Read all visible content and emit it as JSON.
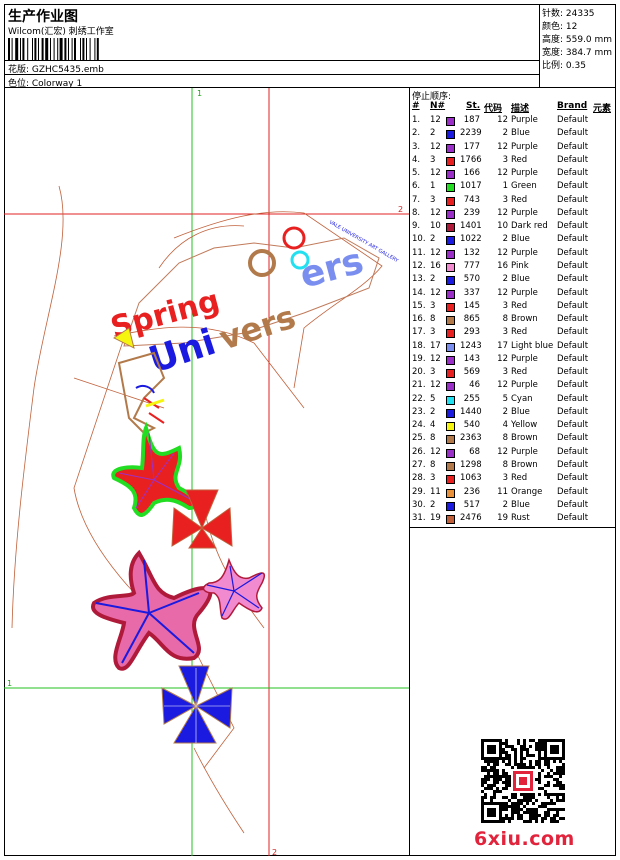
{
  "header": {
    "title": "生产作业图",
    "company": "Wilcom(汇宏) 刺绣工作室",
    "design_label": "花版: GZHC5435.emb",
    "colorway_label": "色位: Colorway 1"
  },
  "stats": {
    "stitches": "针数: 24335",
    "colors": "颜色: 12",
    "height": "高度: 559.0 mm",
    "width": "宽度: 384.7 mm",
    "scale": "比例: 0.35"
  },
  "design": {
    "axis_labels": {
      "top": "1",
      "right": "2",
      "left": "1",
      "bottom": "2"
    },
    "small_text": "VALE UNIVERSITY ART GALLERY"
  },
  "legend": {
    "title": "停止顺序:",
    "headers": {
      "index": "#",
      "needle": "N#",
      "stitches": "St.",
      "code": "代码",
      "desc": "描述",
      "brand": "Brand",
      "element": "元素"
    },
    "rows": [
      {
        "i": "1.",
        "n": "12",
        "color": "#9b30c8",
        "st": "187",
        "code": "12",
        "desc": "Purple",
        "brand": "Default"
      },
      {
        "i": "2.",
        "n": "2",
        "color": "#1a1ae0",
        "st": "2239",
        "code": "2",
        "desc": "Blue",
        "brand": "Default"
      },
      {
        "i": "3.",
        "n": "12",
        "color": "#9b30c8",
        "st": "177",
        "code": "12",
        "desc": "Purple",
        "brand": "Default"
      },
      {
        "i": "4.",
        "n": "3",
        "color": "#e82020",
        "st": "1766",
        "code": "3",
        "desc": "Red",
        "brand": "Default"
      },
      {
        "i": "5.",
        "n": "12",
        "color": "#9b30c8",
        "st": "166",
        "code": "12",
        "desc": "Purple",
        "brand": "Default"
      },
      {
        "i": "6.",
        "n": "1",
        "color": "#22dd22",
        "st": "1017",
        "code": "1",
        "desc": "Green",
        "brand": "Default"
      },
      {
        "i": "7.",
        "n": "3",
        "color": "#e82020",
        "st": "743",
        "code": "3",
        "desc": "Red",
        "brand": "Default"
      },
      {
        "i": "8.",
        "n": "12",
        "color": "#9b30c8",
        "st": "239",
        "code": "12",
        "desc": "Purple",
        "brand": "Default"
      },
      {
        "i": "9.",
        "n": "10",
        "color": "#b01a3a",
        "st": "1401",
        "code": "10",
        "desc": "Dark red",
        "brand": "Default"
      },
      {
        "i": "10.",
        "n": "2",
        "color": "#1a1ae0",
        "st": "1022",
        "code": "2",
        "desc": "Blue",
        "brand": "Default"
      },
      {
        "i": "11.",
        "n": "12",
        "color": "#9b30c8",
        "st": "132",
        "code": "12",
        "desc": "Purple",
        "brand": "Default"
      },
      {
        "i": "12.",
        "n": "16",
        "color": "#f28ad0",
        "st": "777",
        "code": "16",
        "desc": "Pink",
        "brand": "Default"
      },
      {
        "i": "13.",
        "n": "2",
        "color": "#1a1ae0",
        "st": "570",
        "code": "2",
        "desc": "Blue",
        "brand": "Default"
      },
      {
        "i": "14.",
        "n": "12",
        "color": "#9b30c8",
        "st": "337",
        "code": "12",
        "desc": "Purple",
        "brand": "Default"
      },
      {
        "i": "15.",
        "n": "3",
        "color": "#e82020",
        "st": "145",
        "code": "3",
        "desc": "Red",
        "brand": "Default"
      },
      {
        "i": "16.",
        "n": "8",
        "color": "#b27a4a",
        "st": "865",
        "code": "8",
        "desc": "Brown",
        "brand": "Default"
      },
      {
        "i": "17.",
        "n": "3",
        "color": "#e82020",
        "st": "293",
        "code": "3",
        "desc": "Red",
        "brand": "Default"
      },
      {
        "i": "18.",
        "n": "17",
        "color": "#7a8ef0",
        "st": "1243",
        "code": "17",
        "desc": "Light blue",
        "brand": "Default"
      },
      {
        "i": "19.",
        "n": "12",
        "color": "#9b30c8",
        "st": "143",
        "code": "12",
        "desc": "Purple",
        "brand": "Default"
      },
      {
        "i": "20.",
        "n": "3",
        "color": "#e82020",
        "st": "569",
        "code": "3",
        "desc": "Red",
        "brand": "Default"
      },
      {
        "i": "21.",
        "n": "12",
        "color": "#9b30c8",
        "st": "46",
        "code": "12",
        "desc": "Purple",
        "brand": "Default"
      },
      {
        "i": "22.",
        "n": "5",
        "color": "#22e0f0",
        "st": "255",
        "code": "5",
        "desc": "Cyan",
        "brand": "Default"
      },
      {
        "i": "23.",
        "n": "2",
        "color": "#1a1ae0",
        "st": "1440",
        "code": "2",
        "desc": "Blue",
        "brand": "Default"
      },
      {
        "i": "24.",
        "n": "4",
        "color": "#f5f510",
        "st": "540",
        "code": "4",
        "desc": "Yellow",
        "brand": "Default"
      },
      {
        "i": "25.",
        "n": "8",
        "color": "#b27a4a",
        "st": "2363",
        "code": "8",
        "desc": "Brown",
        "brand": "Default"
      },
      {
        "i": "26.",
        "n": "12",
        "color": "#9b30c8",
        "st": "68",
        "code": "12",
        "desc": "Purple",
        "brand": "Default"
      },
      {
        "i": "27.",
        "n": "8",
        "color": "#b27a4a",
        "st": "1298",
        "code": "8",
        "desc": "Brown",
        "brand": "Default"
      },
      {
        "i": "28.",
        "n": "3",
        "color": "#e82020",
        "st": "1063",
        "code": "3",
        "desc": "Red",
        "brand": "Default"
      },
      {
        "i": "29.",
        "n": "11",
        "color": "#e8903a",
        "st": "236",
        "code": "11",
        "desc": "Orange",
        "brand": "Default"
      },
      {
        "i": "30.",
        "n": "2",
        "color": "#1a1ae0",
        "st": "517",
        "code": "2",
        "desc": "Blue",
        "brand": "Default"
      },
      {
        "i": "31.",
        "n": "19",
        "color": "#c0603a",
        "st": "2476",
        "code": "19",
        "desc": "Rust",
        "brand": "Default"
      }
    ]
  },
  "footer": {
    "watermark": "6xiu.com",
    "qr_icon": "qr-code-icon"
  }
}
